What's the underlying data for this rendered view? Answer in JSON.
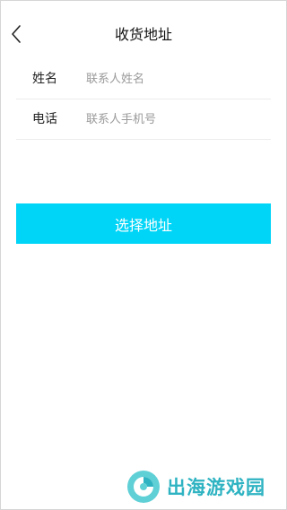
{
  "header": {
    "title": "收货地址"
  },
  "form": {
    "name_label": "姓名",
    "name_placeholder": "联系人姓名",
    "name_value": "",
    "phone_label": "电话",
    "phone_placeholder": "联系人手机号",
    "phone_value": ""
  },
  "actions": {
    "select_address_label": "选择地址"
  },
  "watermark": {
    "text": "出海游戏园"
  },
  "colors": {
    "accent": "#00d5f7",
    "watermark": "#2fb3c2"
  },
  "icons": {
    "back": "chevron-left-icon"
  }
}
